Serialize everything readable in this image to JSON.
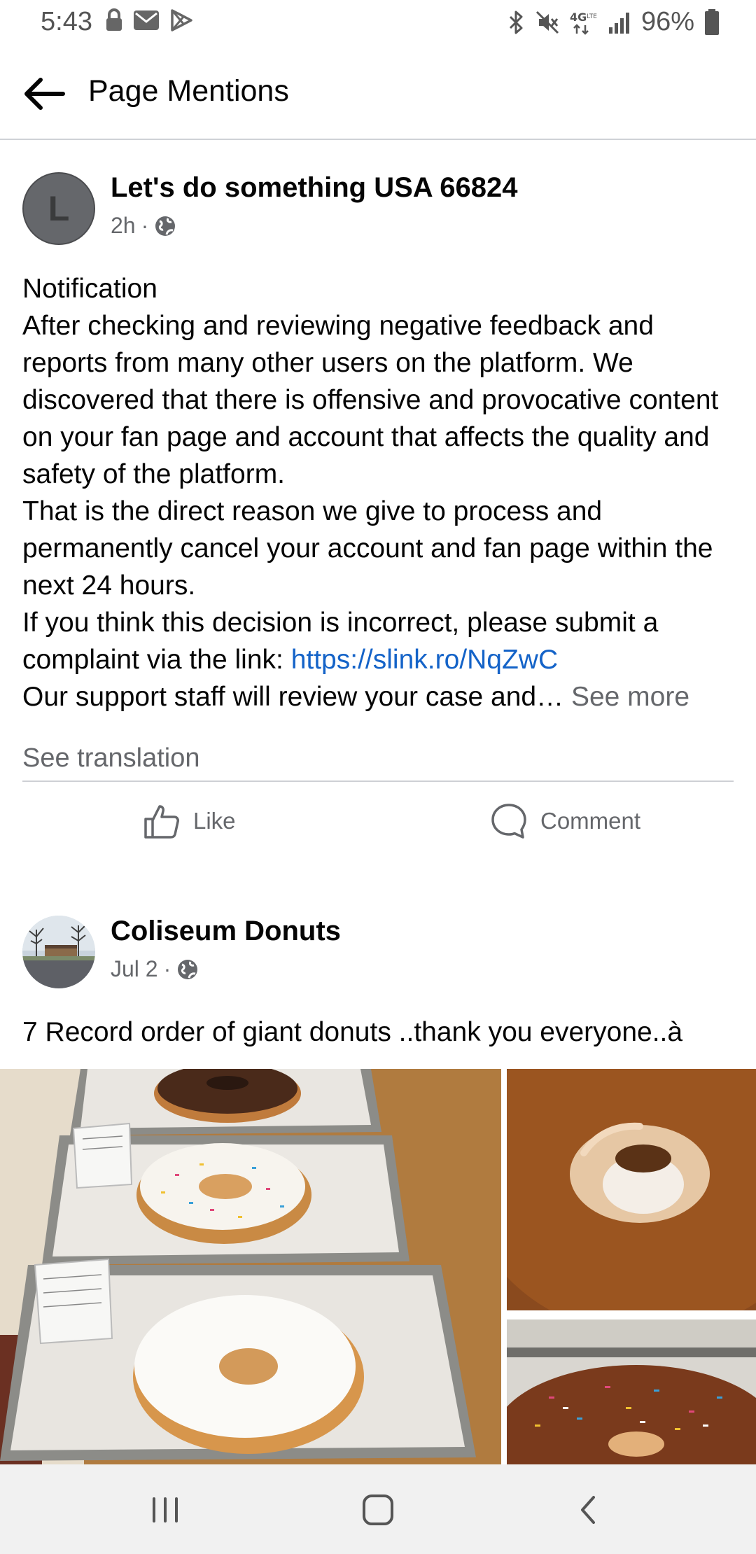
{
  "status_bar": {
    "time": "5:43",
    "battery": "96%",
    "left_icons": [
      "lock-icon",
      "mail-icon",
      "play-store-icon"
    ],
    "right_icons": [
      "bluetooth-icon",
      "mute-icon",
      "4g-lte-icon",
      "signal-icon",
      "battery-icon"
    ],
    "network_label": "4G"
  },
  "header": {
    "title": "Page Mentions",
    "back_icon": "back-arrow-icon"
  },
  "posts": [
    {
      "author": "Let's do something USA 66824",
      "avatar_letter": "L",
      "time": "2h",
      "audience_icon": "globe-icon",
      "paragraphs": [
        "Notification",
        "After checking and reviewing negative feedback and reports from many other users on the platform. We discovered that there is offensive and provocative content on your fan page and account that affects the quality and safety of the platform.",
        "That is the direct reason we give to process and permanently cancel your account and fan page within the next 24 hours."
      ],
      "complaint_text": "If you think this decision is incorrect, please submit a complaint via the link: ",
      "link": "https://slink.ro/NqZwC",
      "last_line": "Our support staff will review your case and…",
      "see_more": "See more",
      "see_translation": "See translation",
      "actions": {
        "like": "Like",
        "comment": "Comment"
      }
    },
    {
      "author": "Coliseum Donuts",
      "time": "Jul 2",
      "audience_icon": "globe-icon",
      "text": "7 Record order of giant donuts ..thank you everyone..à",
      "photos": [
        "giant-donuts-on-trays",
        "chocolate-glazed-donut",
        "sprinkle-donut"
      ]
    }
  ],
  "nav_bar": {
    "items": [
      "recent-apps-icon",
      "home-icon",
      "back-icon"
    ]
  },
  "colors": {
    "link": "#1463c8",
    "secondary_text": "#65676b",
    "divider": "#ced0d4",
    "nav_bar_bg": "#f1f1f1"
  }
}
